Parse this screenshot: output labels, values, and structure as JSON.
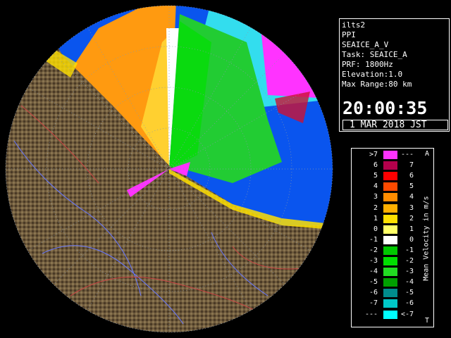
{
  "info": {
    "lines": [
      "ilts2",
      "PPI",
      "SEAICE_A_V",
      "Task: SEAICE_A",
      "PRF: 1800Hz",
      "Elevation:1.0",
      "Max Range:80 km"
    ],
    "time": "20:00:35",
    "date": "1 MAR 2018 JST"
  },
  "legend": {
    "title": "Mean Velocity in m/s",
    "corner_top": "A",
    "corner_bottom": "T",
    "rows": [
      {
        "left": ">7",
        "right": "---",
        "color": "#ff33ff"
      },
      {
        "left": "6",
        "right": "7",
        "color": "#b4004b"
      },
      {
        "left": "5",
        "right": "6",
        "color": "#ff0000"
      },
      {
        "left": "4",
        "right": "5",
        "color": "#ff4a00"
      },
      {
        "left": "3",
        "right": "4",
        "color": "#ff8c00"
      },
      {
        "left": "2",
        "right": "3",
        "color": "#ffb000"
      },
      {
        "left": "1",
        "right": "2",
        "color": "#ffe000"
      },
      {
        "left": "0",
        "right": "1",
        "color": "#ffff66"
      },
      {
        "left": "-1",
        "right": "0",
        "color": "#ffffff"
      },
      {
        "left": "-2",
        "right": "-1",
        "color": "#00c800"
      },
      {
        "left": "-3",
        "right": "-2",
        "color": "#00e000"
      },
      {
        "left": "-4",
        "right": "-3",
        "color": "#22dd22"
      },
      {
        "left": "-5",
        "right": "-4",
        "color": "#00a000"
      },
      {
        "left": "-6",
        "right": "-5",
        "color": "#008c8c"
      },
      {
        "left": "-7",
        "right": "-6",
        "color": "#00c8c8"
      },
      {
        "left": "---",
        "right": "<-7",
        "color": "#00ffff"
      }
    ]
  },
  "colors": {
    "ocean": "#0a55ee",
    "land": "#6e5a3c",
    "range_ring": "#8899aa"
  }
}
